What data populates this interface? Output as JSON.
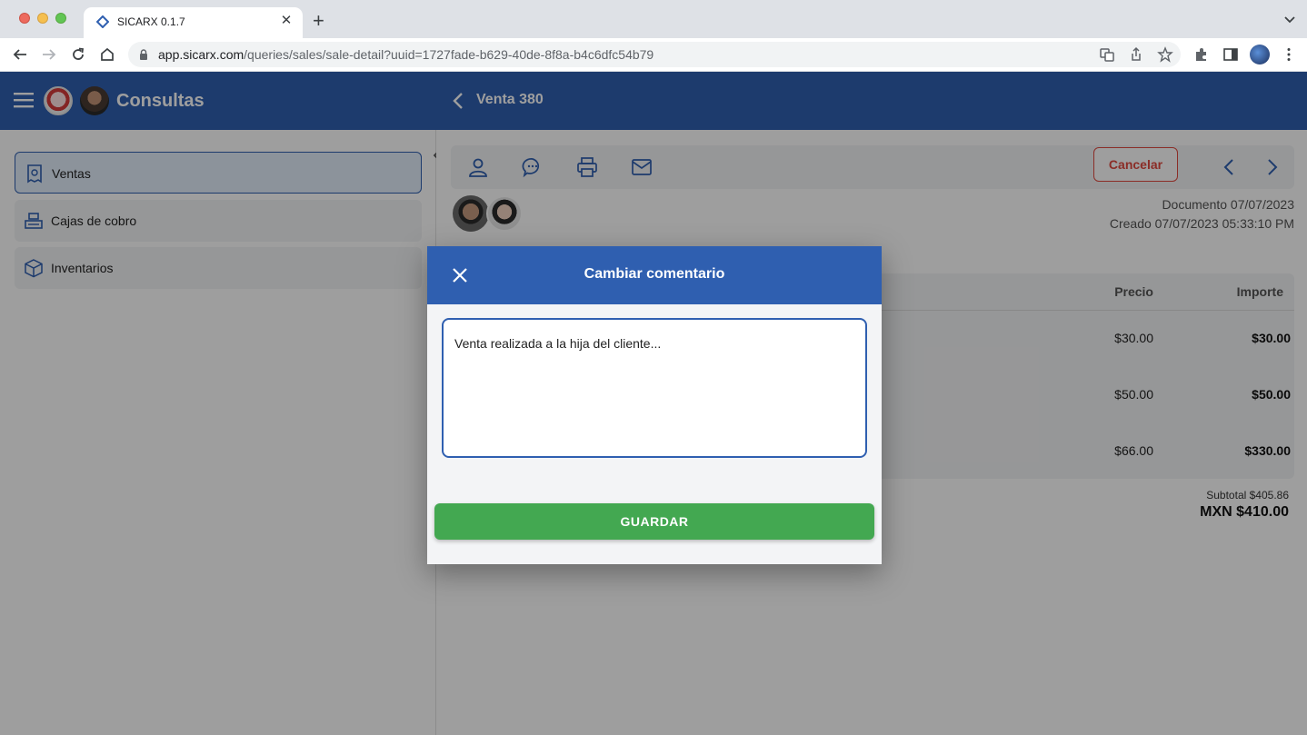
{
  "browser": {
    "tab_title": "SICARX 0.1.7",
    "url_domain": "app.sicarx.com",
    "url_path": "/queries/sales/sale-detail?uuid=1727fade-b629-40de-8f8a-b4c6dfc54b79"
  },
  "header": {
    "app_title": "Consultas",
    "page_title": "Venta 380",
    "color": "#2f5fb0"
  },
  "sidebar": {
    "items": [
      {
        "label": "Ventas",
        "icon": "receipt-icon",
        "active": true
      },
      {
        "label": "Cajas de cobro",
        "icon": "cash-register-icon",
        "active": false
      },
      {
        "label": "Inventarios",
        "icon": "box-icon",
        "active": false
      }
    ]
  },
  "detail": {
    "cancel_label": "Cancelar",
    "document_date": "Documento 07/07/2023",
    "created_date": "Creado 07/07/2023 05:33:10 PM",
    "columns": {
      "price": "Precio",
      "amount": "Importe"
    },
    "rows": [
      {
        "price": "$30.00",
        "amount": "$30.00"
      },
      {
        "price": "$50.00",
        "amount": "$50.00"
      },
      {
        "price": "$66.00",
        "amount": "$330.00"
      }
    ],
    "subtotal": "Subtotal $405.86",
    "total": "MXN $410.00"
  },
  "modal": {
    "title": "Cambiar comentario",
    "comment_value": "Venta realizada a la hija del cliente...",
    "save_label": "GUARDAR",
    "save_color": "#43a851"
  }
}
